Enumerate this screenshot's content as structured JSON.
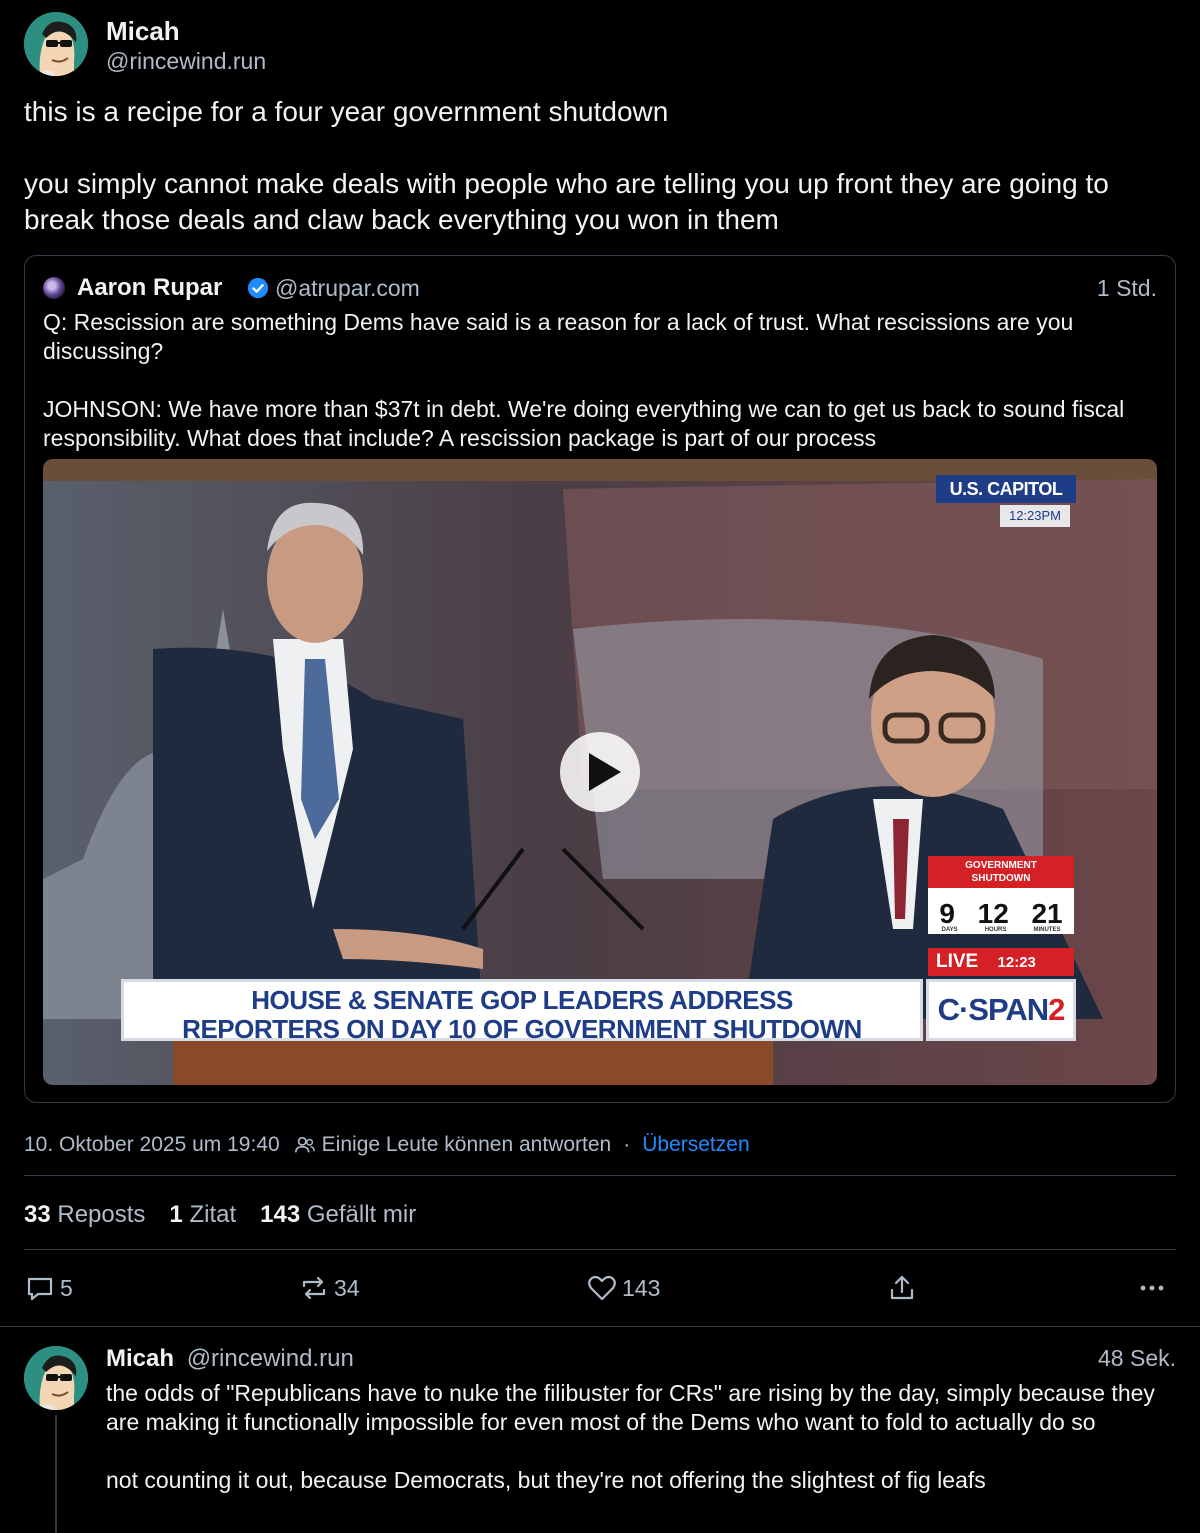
{
  "post": {
    "author": {
      "name": "Micah",
      "handle": "@rincewind.run",
      "avatar_icon": "cartoon-avatar-icon"
    },
    "text_paragraphs": [
      "this is a recipe for a four year government shutdown",
      "you simply cannot make deals with people who are telling you up front they are going to break those deals and claw back everything you won in them"
    ],
    "quote": {
      "author_name": "Aaron Rupar",
      "verified": true,
      "handle": "@atrupar.com",
      "time": "1 Std.",
      "paragraphs": [
        "Q: Rescission are something Dems have said is a reason for a lack of trust. What rescissions are you discussing?",
        "JOHNSON: We have more than $37t in debt. We're doing everything we can to get us back to sound fiscal responsibility. What does that include? A rescission package is part of our process"
      ],
      "video": {
        "badge_title": "U.S. CAPITOL",
        "badge_time": "12:23PM",
        "shutdown_label_1": "GOVERNMENT",
        "shutdown_label_2": "SHUTDOWN",
        "shutdown_days": "9",
        "shutdown_hours": "12",
        "shutdown_minutes": "21",
        "unit_days": "DAYS",
        "unit_hours": "HOURS",
        "unit_minutes": "MINUTES",
        "live_label": "LIVE",
        "live_time": "12:23",
        "lower_third_line1": "HOUSE & SENATE GOP LEADERS ADDRESS",
        "lower_third_line2": "REPORTERS ON DAY 10 OF GOVERNMENT SHUTDOWN",
        "network_a": "C·SPAN",
        "network_b": "2",
        "play_icon": "play-icon"
      }
    },
    "meta": {
      "date": "10. Oktober 2025 um 19:40",
      "reply_setting": "Einige Leute können antworten",
      "separator": "·",
      "translate": "Übersetzen"
    },
    "stats": {
      "reposts_count": "33",
      "reposts_label": "Reposts",
      "quotes_count": "1",
      "quotes_label": "Zitat",
      "likes_count": "143",
      "likes_label": "Gefällt mir"
    },
    "actions": {
      "reply_count": "5",
      "repost_count": "34",
      "like_count": "143"
    }
  },
  "reply": {
    "author_name": "Micah",
    "handle": "@rincewind.run",
    "time": "48 Sek.",
    "paragraphs": [
      "the odds of \"Republicans have to nuke the filibuster for CRs\" are rising by the day, simply because they are making it functionally impossible for even most of the Dems who want to fold to actually do so",
      "not counting it out, because Democrats, but they're not offering the slightest of fig leafs"
    ]
  },
  "colors": {
    "background": "#000000",
    "text": "#f1f3f5",
    "muted": "#aebbc9",
    "link": "#208bfe",
    "border": "#2e3a46",
    "cspan_blue": "#1f3d86",
    "alert_red": "#d32125"
  }
}
